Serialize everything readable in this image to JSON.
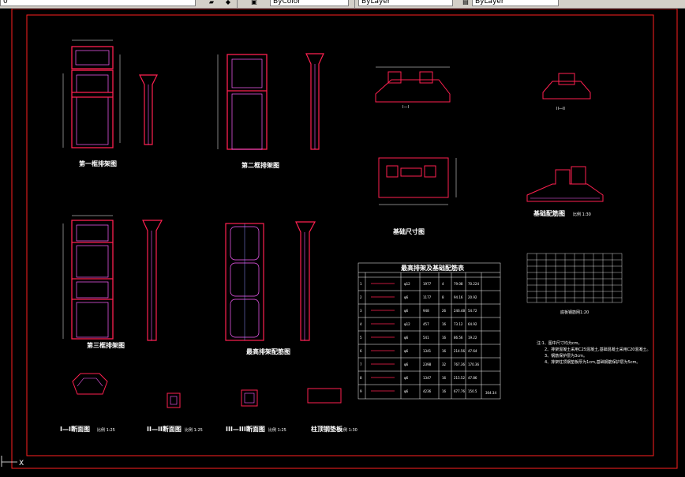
{
  "toolbar": {
    "layer_field": "0",
    "style_field": "ByLayer",
    "lineweight_field": "ByLayer",
    "color_field": "ByColor"
  },
  "drawing": {
    "title1": "第一框排架图",
    "title2": "第二框排架图",
    "title3": "第三框排架图",
    "title4": "最高排架配筋图",
    "foundation_title": "基础尺寸图",
    "foundation_rebar_title": "基础配筋图",
    "foundation_rebar_scale": "比例 1:30",
    "mesh_title": "底板钢筋网1:20",
    "section1": "I—I断面图",
    "section1_scale": "比例 1:25",
    "section2": "II—II断面图",
    "section2_scale": "比例 1:25",
    "section3": "III—III断面图",
    "section3_scale": "比例 1:25",
    "plate": "柱顶钢垫板",
    "plate_scale": "比例 1:30",
    "table_title": "最高排架及基础配筋表",
    "sec_label_I": "I—I",
    "sec_label_II": "II—II",
    "notes": [
      "注:1、图中尺寸均为cm。",
      "2、排架混凝土采用C25混凝土,基础混凝土采用C20混凝土。",
      "3、钢筋保护层为3cm。",
      "4、排架柱顶钢垫板厚为1cm,基础钢筋保护层为5cm。"
    ]
  },
  "table": {
    "rows": [
      "1",
      "2",
      "3",
      "4",
      "5",
      "6",
      "7",
      "8",
      "9"
    ],
    "c_dia": [
      "φ12",
      "φ6",
      "φ6",
      "φ12",
      "φ6",
      "φ6",
      "φ6",
      "φ6",
      "φ6"
    ],
    "c_len": [
      "1977",
      "1177",
      "948",
      "457",
      "541",
      "1341",
      "2398",
      "1347",
      "4236"
    ],
    "c_num": [
      "4",
      "8",
      "26",
      "16",
      "16",
      "16",
      "32",
      "16",
      "16"
    ],
    "c_total": [
      "79.08",
      "94.16",
      "246.48",
      "73.12",
      "86.56",
      "214.56",
      "767.36",
      "215.52",
      "677.76"
    ],
    "c_weight": [
      "70.224",
      "20.92",
      "54.72",
      "64.92",
      "19.22",
      "47.64",
      "170.36",
      "47.86",
      "150.5"
    ],
    "total_label": "304.34"
  },
  "cmdline": {
    "prompt": "X"
  }
}
